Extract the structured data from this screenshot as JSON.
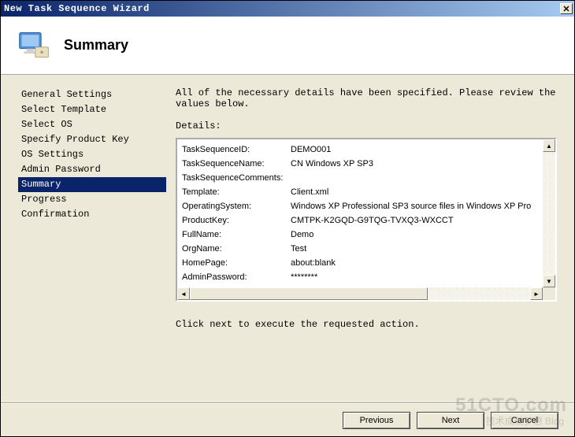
{
  "window": {
    "title": "New Task Sequence Wizard"
  },
  "header": {
    "title": "Summary"
  },
  "sidebar": {
    "items": [
      {
        "label": "General Settings",
        "selected": false
      },
      {
        "label": "Select Template",
        "selected": false
      },
      {
        "label": "Select OS",
        "selected": false
      },
      {
        "label": "Specify Product Key",
        "selected": false
      },
      {
        "label": "OS Settings",
        "selected": false
      },
      {
        "label": "Admin Password",
        "selected": false
      },
      {
        "label": "Summary",
        "selected": true
      },
      {
        "label": "Progress",
        "selected": false
      },
      {
        "label": "Confirmation",
        "selected": false
      }
    ]
  },
  "main": {
    "instruction": "All of the necessary details have been specified.  Please review the values below.",
    "details_label": "Details:",
    "details": [
      {
        "label": "TaskSequenceID:",
        "value": "DEMO001"
      },
      {
        "label": "TaskSequenceName:",
        "value": "CN Windows XP SP3"
      },
      {
        "label": "TaskSequenceComments:",
        "value": ""
      },
      {
        "label": "Template:",
        "value": "Client.xml"
      },
      {
        "label": "OperatingSystem:",
        "value": "Windows XP Professional SP3 source files in Windows XP Pro"
      },
      {
        "label": "ProductKey:",
        "value": "CMTPK-K2GQD-G9TQG-TVXQ3-WXCCT"
      },
      {
        "label": "FullName:",
        "value": "Demo"
      },
      {
        "label": "OrgName:",
        "value": "Test"
      },
      {
        "label": "HomePage:",
        "value": "about:blank"
      },
      {
        "label": "AdminPassword:",
        "value": "********"
      }
    ],
    "footer": "Click next to execute the requested action."
  },
  "buttons": {
    "previous": "Previous",
    "next": "Next",
    "cancel": "Cancel"
  },
  "watermark": {
    "main": "51CTO.com",
    "sub": "技术成就梦想 Blog"
  }
}
